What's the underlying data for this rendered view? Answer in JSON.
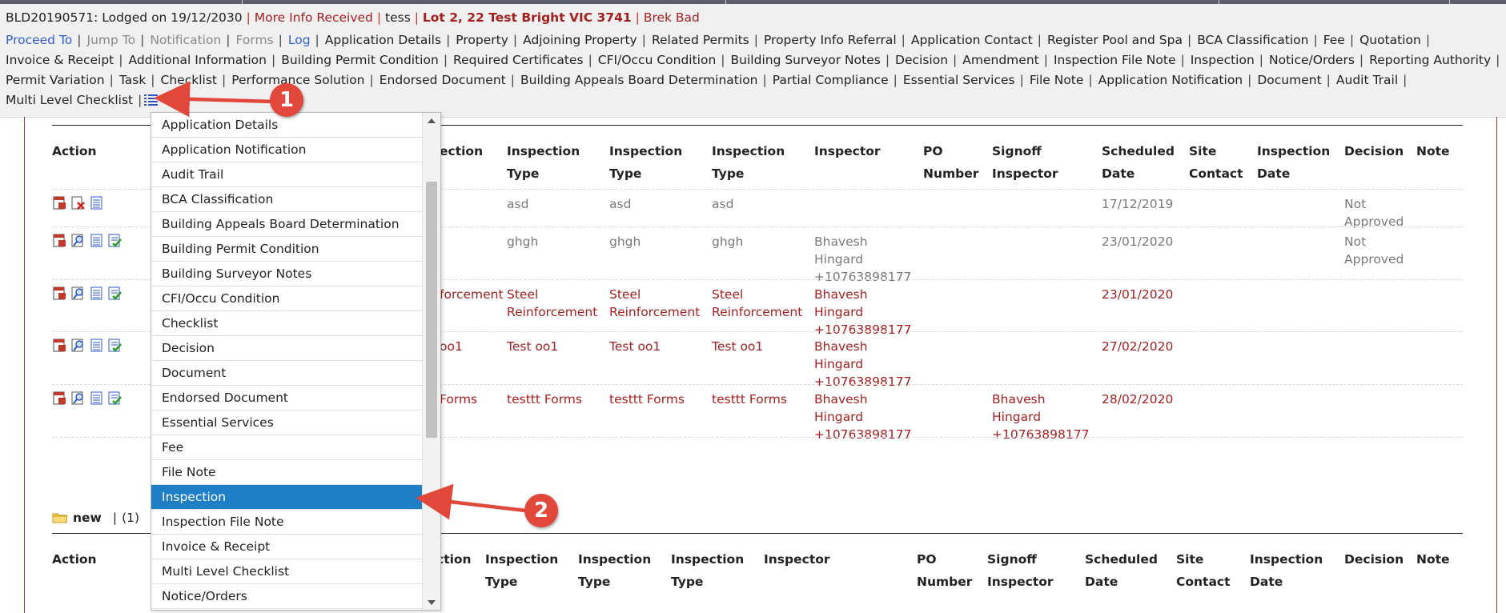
{
  "title": {
    "ref": "BLD20190571: Lodged on 19/12/2030",
    "status": "More Info Received",
    "user": "tess",
    "address": "Lot 2, 22 Test Bright VIC 3741",
    "applicant": "Brek Bad",
    "separator": "|"
  },
  "nav": {
    "line1": [
      "Proceed To",
      "Jump To",
      "Notification",
      "Forms",
      "Log",
      "Application Details",
      "Property",
      "Adjoining Property",
      "Related Permits",
      "Property Info Referral",
      "Application Contact",
      "Register Pool and Spa",
      "BCA Classification",
      "Fee",
      "Quotation"
    ],
    "line2": [
      "Invoice & Receipt",
      "Additional Information",
      "Building Permit Condition",
      "Required Certificates",
      "CFI/Occu Condition",
      "Building Surveyor Notes",
      "Decision",
      "Amendment",
      "Inspection File Note",
      "Inspection",
      "Notice/Orders",
      "Reporting Authority"
    ],
    "line3": [
      "Permit Variation",
      "Task",
      "Checklist",
      "Performance Solution",
      "Endorsed Document",
      "Building Appeals Board Determination",
      "Partial Compliance",
      "Essential Services",
      "File Note",
      "Application Notification",
      "Document",
      "Audit Trail"
    ],
    "line4": [
      "Multi Level Checklist"
    ]
  },
  "table1": {
    "headers": {
      "action": "Action",
      "partial_col": "ection",
      "type1": [
        "Inspection",
        "Type"
      ],
      "type2": [
        "Inspection",
        "Type"
      ],
      "type3": [
        "Inspection",
        "Type"
      ],
      "inspector": "Inspector",
      "po": [
        "PO",
        "Number"
      ],
      "signoff": [
        "Signoff",
        "Inspector"
      ],
      "scheduled": [
        "Scheduled",
        "Date"
      ],
      "site": [
        "Site",
        "Contact"
      ],
      "insp_date": [
        "Inspection",
        "Date"
      ],
      "decision": "Decision",
      "note": "Note"
    },
    "rows": [
      {
        "partial": "",
        "t1": "asd",
        "t2": "asd",
        "t3": "asd",
        "inspector": [],
        "signoff": [],
        "scheduled": "17/12/2019",
        "decision": [
          "Not",
          "Approved"
        ],
        "color": "grey"
      },
      {
        "partial": "",
        "t1": "ghgh",
        "t2": "ghgh",
        "t3": "ghgh",
        "inspector": [
          "Bhavesh",
          "Hingard",
          "+10763898177"
        ],
        "signoff": [],
        "scheduled": "23/01/2020",
        "decision": [
          "Not",
          "Approved"
        ],
        "color": "grey"
      },
      {
        "partial": "forcement",
        "t1": [
          "Steel",
          "Reinforcement"
        ],
        "t2": [
          "Steel",
          "Reinforcement"
        ],
        "t3": [
          "Steel",
          "Reinforcement"
        ],
        "inspector": [
          "Bhavesh",
          "Hingard",
          "+10763898177"
        ],
        "signoff": [],
        "scheduled": "23/01/2020",
        "decision": [],
        "color": "red"
      },
      {
        "partial": "oo1",
        "t1": "Test oo1",
        "t2": "Test oo1",
        "t3": "Test oo1",
        "inspector": [
          "Bhavesh",
          "Hingard",
          "+10763898177"
        ],
        "signoff": [],
        "scheduled": "27/02/2020",
        "decision": [],
        "color": "red"
      },
      {
        "partial": "Forms",
        "t1": "testtt Forms",
        "t2": "testtt Forms",
        "t3": "testtt Forms",
        "inspector": [
          "Bhavesh",
          "Hingard",
          "+10763898177"
        ],
        "signoff": [
          "Bhavesh",
          "Hingard",
          "+10763898177"
        ],
        "scheduled": "28/02/2020",
        "decision": [],
        "color": "red"
      }
    ]
  },
  "group2": {
    "name": "new",
    "count": "(1)",
    "bar": "|"
  },
  "table2": {
    "headers": {
      "action": "Action",
      "partial_col": "ction",
      "type1": [
        "Inspection",
        "Type"
      ],
      "type2": [
        "Inspection",
        "Type"
      ],
      "type3": [
        "Inspection",
        "Type"
      ],
      "inspector": "Inspector",
      "po": [
        "PO",
        "Number"
      ],
      "signoff": [
        "Signoff",
        "Inspector"
      ],
      "scheduled": [
        "Scheduled",
        "Date"
      ],
      "site": [
        "Site",
        "Contact"
      ],
      "insp_date": [
        "Inspection",
        "Date"
      ],
      "decision": "Decision",
      "note": "Note"
    }
  },
  "dropdown": {
    "items": [
      "Application Details",
      "Application Notification",
      "Audit Trail",
      "BCA Classification",
      "Building Appeals Board Determination",
      "Building Permit Condition",
      "Building Surveyor Notes",
      "CFI/Occu Condition",
      "Checklist",
      "Decision",
      "Document",
      "Endorsed Document",
      "Essential Services",
      "Fee",
      "File Note",
      "Inspection",
      "Inspection File Note",
      "Invoice & Receipt",
      "Multi Level Checklist",
      "Notice/Orders"
    ],
    "selected": "Inspection"
  },
  "callouts": [
    "1",
    "2"
  ],
  "colors": {
    "accent_red": "#a51f1f",
    "selected_blue": "#1e7fc6",
    "callout_red": "#e2473c",
    "link_blue": "#2f5fd0"
  },
  "icons": [
    "edit-record-icon",
    "delete-record-icon",
    "view-details-icon",
    "inspect-icon",
    "approve-icon",
    "list-menu-icon",
    "folder-icon"
  ]
}
